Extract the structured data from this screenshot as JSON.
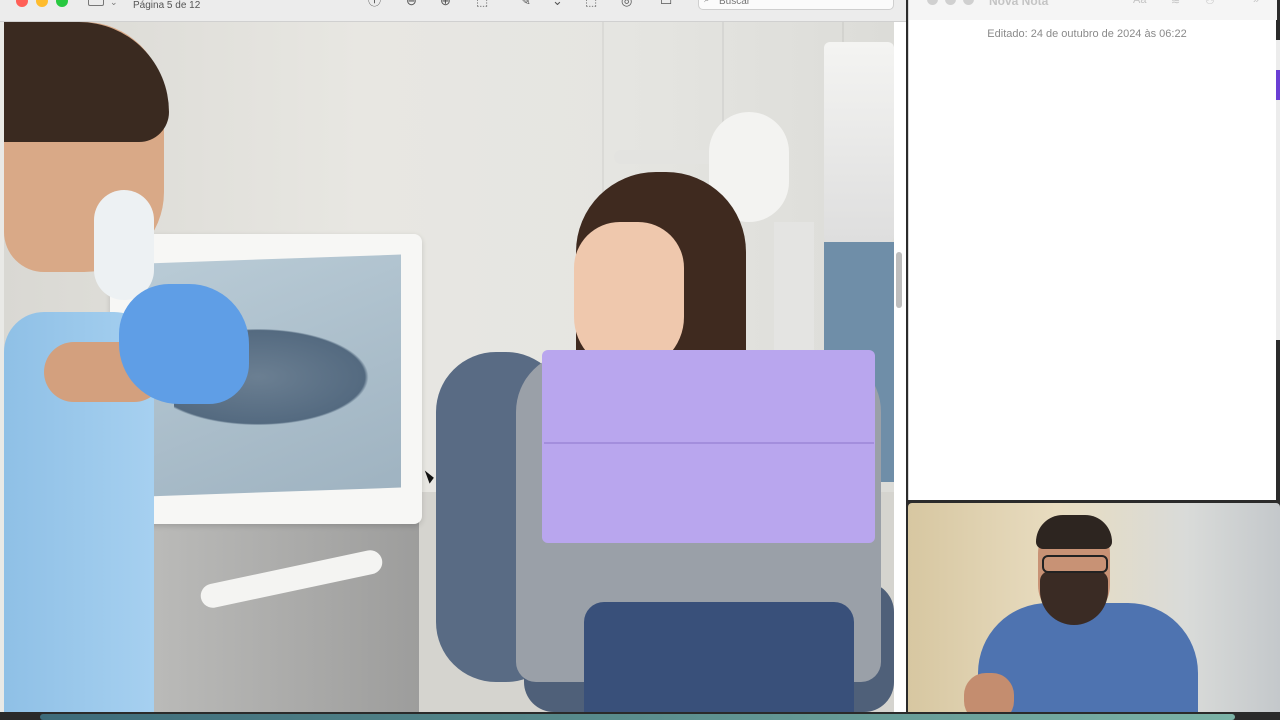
{
  "preview": {
    "page_indicator": "Página 5 de 12",
    "search": {
      "placeholder": "Buscar"
    }
  },
  "notes": {
    "title": "Nova Nota",
    "font_button": "Aa",
    "edited_label": "Editado: 24 de outubro de 2024 às 06:22"
  },
  "colors": {
    "accent": "#6b3fd4",
    "bib": "#b9a6ee",
    "shirt": "#a6d0f0"
  }
}
